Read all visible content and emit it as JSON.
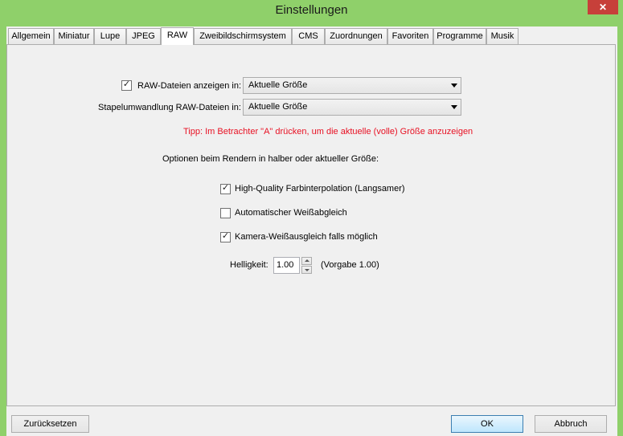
{
  "window": {
    "title": "Einstellungen",
    "close_glyph": "✕",
    "frame_color": "#8fd06a"
  },
  "tabs": [
    {
      "label": "Allgemein",
      "active": false
    },
    {
      "label": "Miniatur",
      "active": false
    },
    {
      "label": "Lupe",
      "active": false
    },
    {
      "label": "JPEG",
      "active": false
    },
    {
      "label": "RAW",
      "active": true
    },
    {
      "label": "Zweibildschirmsystem",
      "active": false
    },
    {
      "label": "CMS",
      "active": false
    },
    {
      "label": "Zuordnungen",
      "active": false
    },
    {
      "label": "Favoriten",
      "active": false
    },
    {
      "label": "Programme",
      "active": false
    },
    {
      "label": "Musik",
      "active": false
    }
  ],
  "raw": {
    "show_raw": {
      "label": "RAW-Dateien anzeigen in:",
      "checked": true
    },
    "show_raw_combo": {
      "value": "Aktuelle Größe"
    },
    "batch_label": "Stapelumwandlung RAW-Dateien in:",
    "batch_combo": {
      "value": "Aktuelle Größe"
    },
    "tip": "Tipp: Im Betrachter \"A\" drücken, um die aktuelle (volle) Größe anzuzeigen",
    "tip_color": "#e81123",
    "options_heading": "Optionen beim Rendern in halber oder aktueller Größe:",
    "options": [
      {
        "label": "High-Quality Farbinterpolation (Langsamer)",
        "checked": true
      },
      {
        "label": "Automatischer Weißabgleich",
        "checked": false
      },
      {
        "label": "Kamera-Weißausgleich falls möglich",
        "checked": true
      }
    ],
    "brightness": {
      "label": "Helligkeit:",
      "value": "1.00",
      "default_text": "(Vorgabe 1.00)"
    }
  },
  "footer": {
    "reset_label": "Zurücksetzen",
    "ok_label": "OK",
    "cancel_label": "Abbruch"
  }
}
